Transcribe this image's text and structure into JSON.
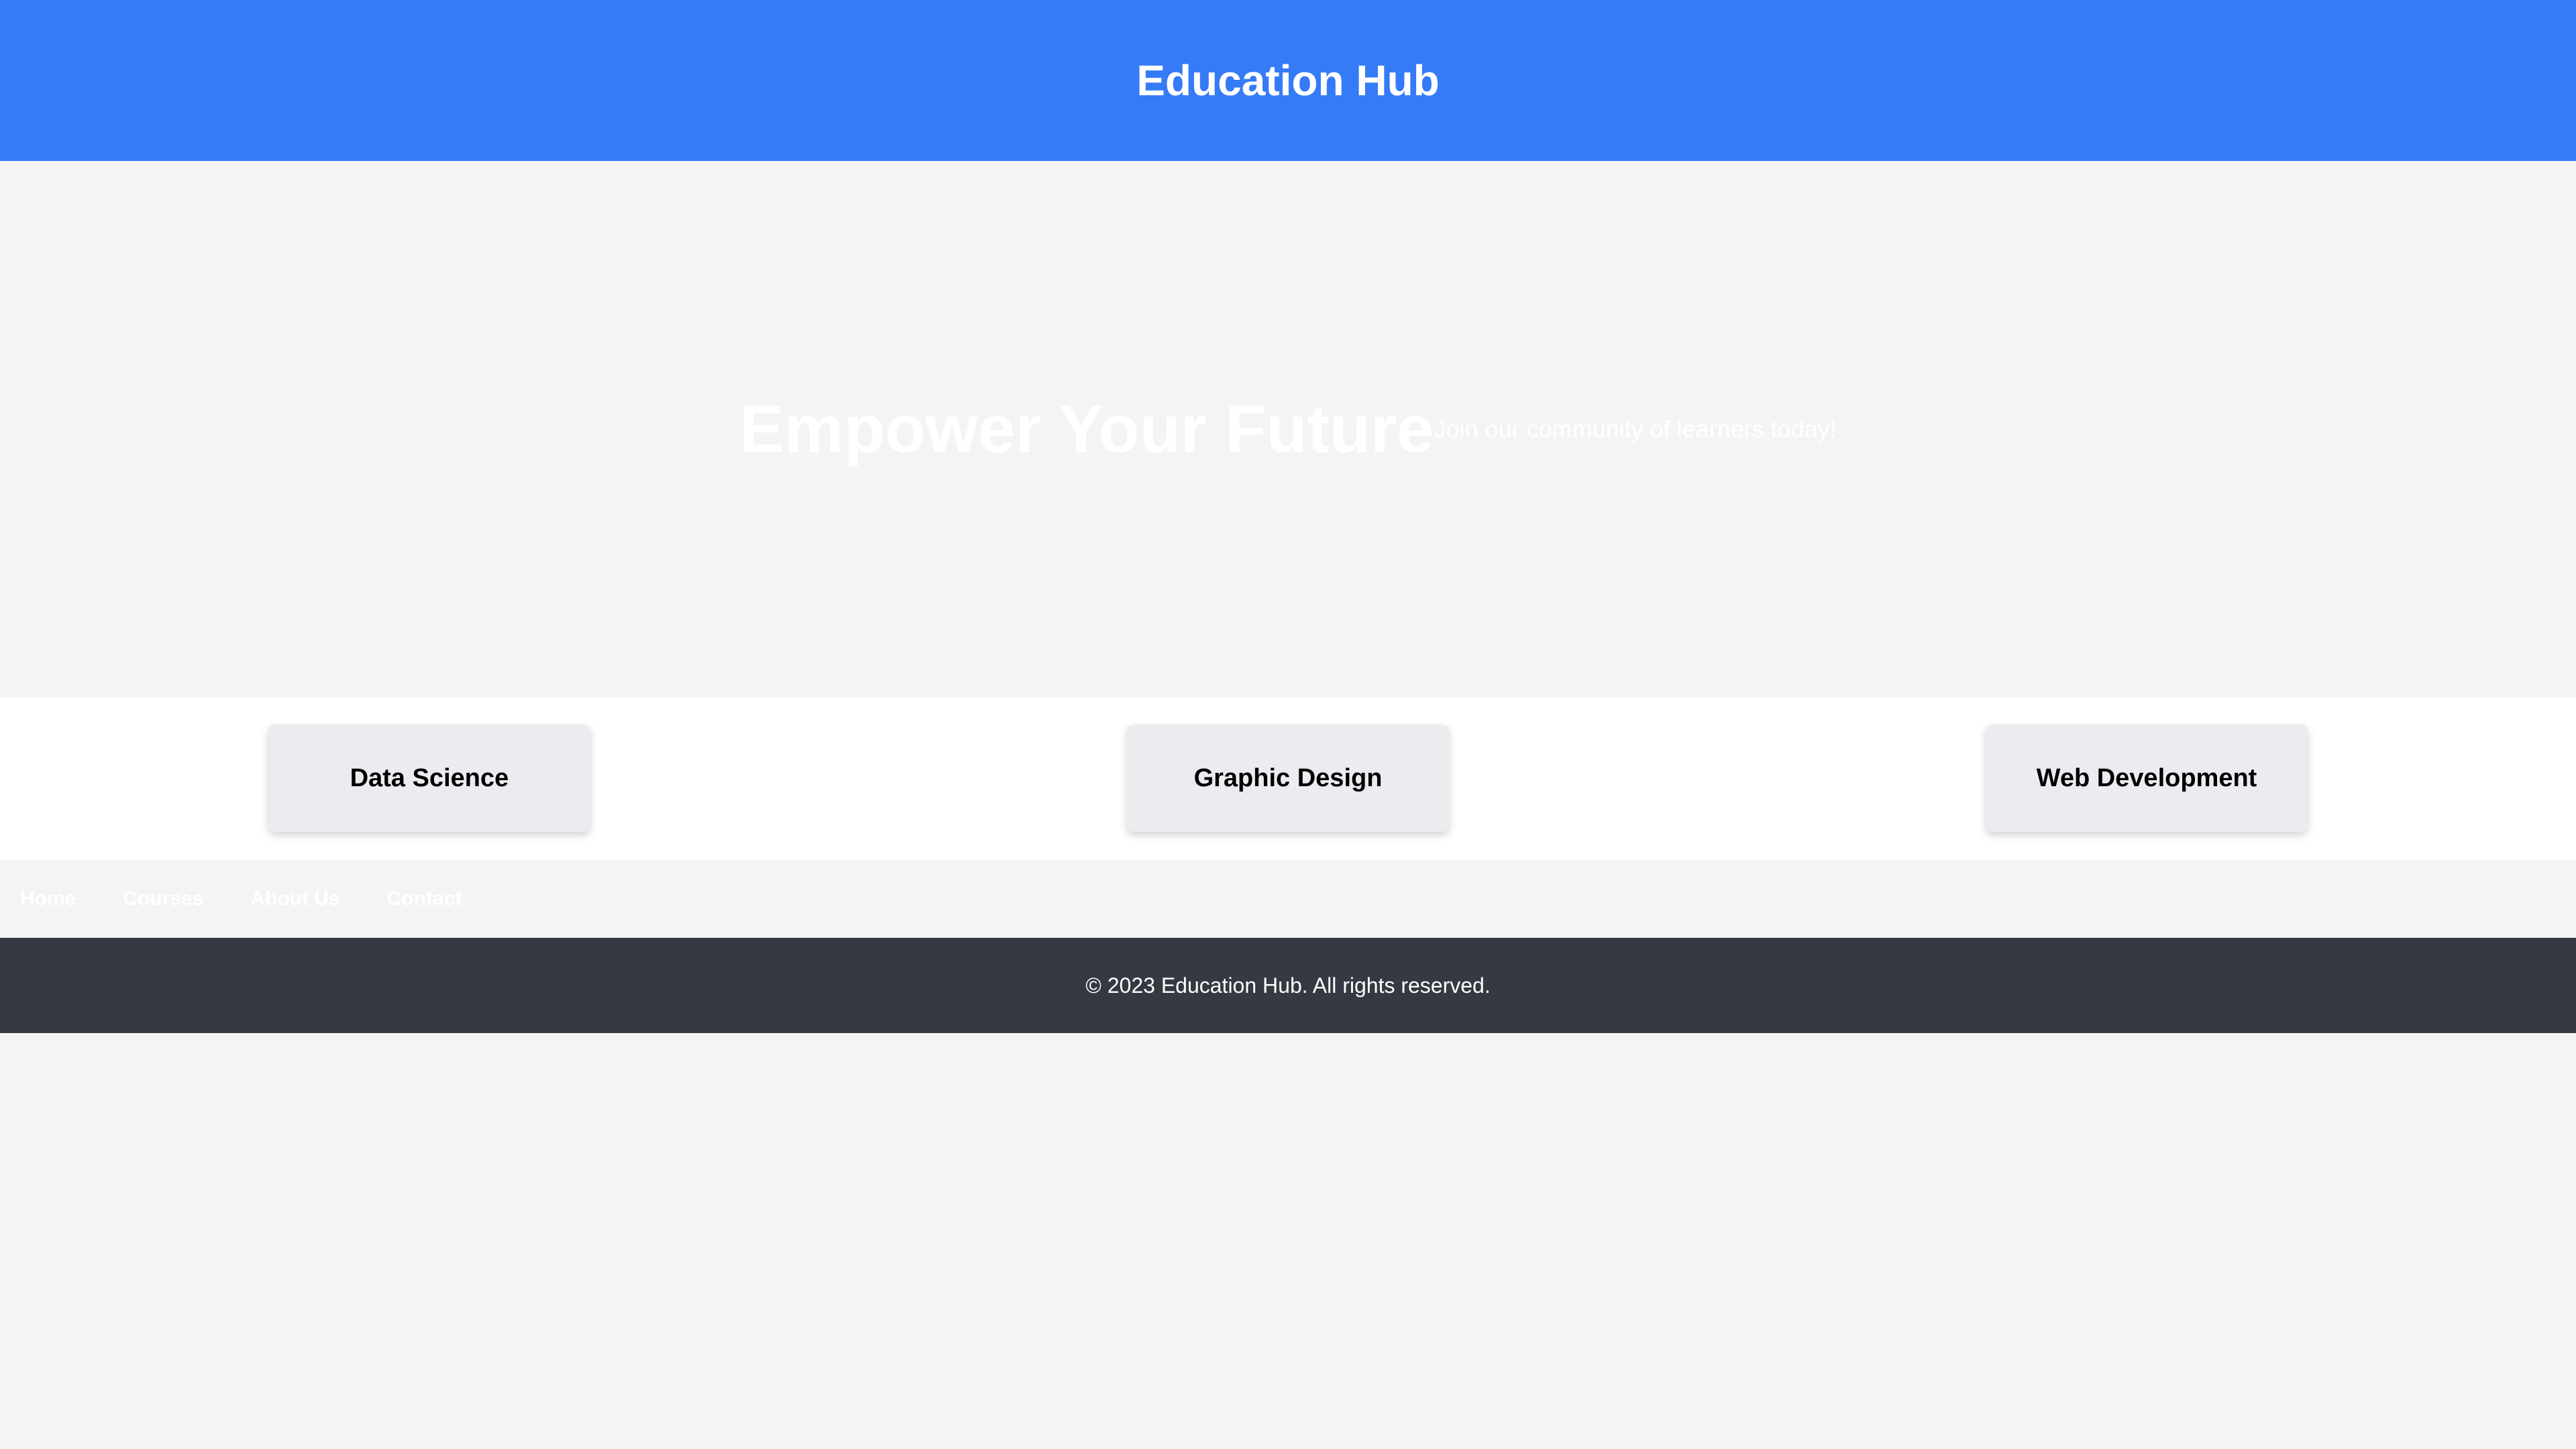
{
  "header": {
    "title": "Education Hub"
  },
  "hero": {
    "title": "Empower Your Future",
    "subtitle": "Join our community of learners today!"
  },
  "courses": [
    {
      "title": "Data Science"
    },
    {
      "title": "Graphic Design"
    },
    {
      "title": "Web Development"
    }
  ],
  "nav": {
    "items": [
      {
        "label": "Home"
      },
      {
        "label": "Courses"
      },
      {
        "label": "About Us"
      },
      {
        "label": "Contact"
      }
    ]
  },
  "footer": {
    "text": "© 2023 Education Hub. All rights reserved."
  },
  "colors": {
    "header_bg": "#367bf6",
    "page_bg": "#f4f4f4",
    "card_bg": "#ebecf0",
    "footer_bg": "#353941"
  }
}
